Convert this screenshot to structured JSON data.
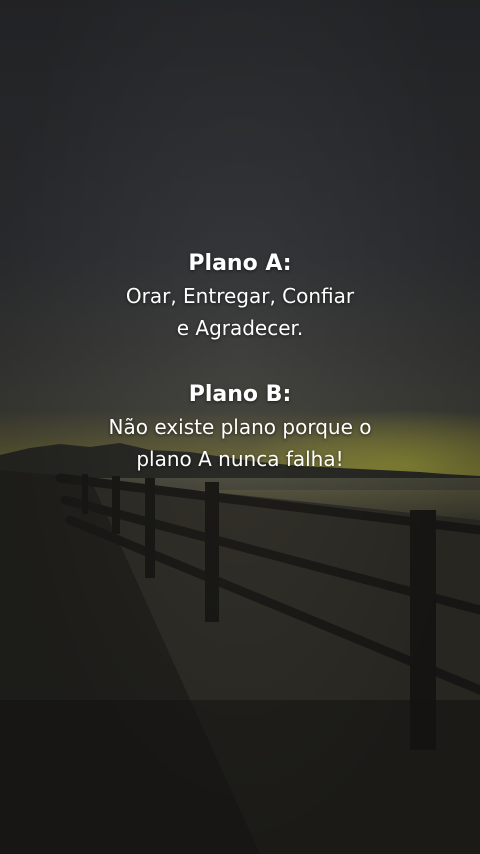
{
  "plan_a": {
    "heading": "Plano A:",
    "line1": "Orar, Entregar, Confiar",
    "line2": "e Agradecer."
  },
  "plan_b": {
    "heading": "Plano B:",
    "line1": "Não existe plano porque o",
    "line2": "plano A nunca falha!"
  },
  "colors": {
    "text": "#ffffff",
    "sky": "#35373a",
    "horizon_glow": "#8a8a3a"
  }
}
